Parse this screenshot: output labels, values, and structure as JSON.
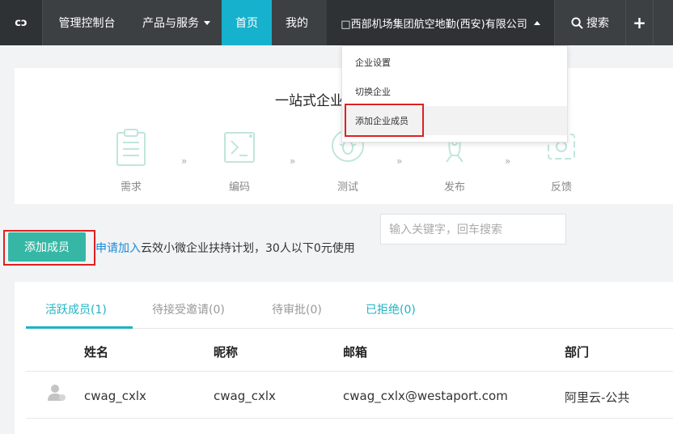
{
  "topbar": {
    "logo": "cɔ",
    "console": "管理控制台",
    "products": "产品与服务",
    "home": "首页",
    "mine": "我的",
    "company": "□西部机场集团航空地勤(西安)有限公司",
    "search": "搜索",
    "plus": "+"
  },
  "dropdown": {
    "items": [
      "企业设置",
      "切换企业",
      "添加企业成员"
    ]
  },
  "hero": {
    "title": "一站式企业",
    "steps": [
      "需求",
      "编码",
      "测试",
      "发布",
      "反馈"
    ],
    "arrow": "»"
  },
  "search_box": {
    "placeholder": "输入关键字，回车搜索"
  },
  "actions": {
    "add_member": "添加成员",
    "promo_link": "申请加入",
    "promo_text": "云效小微企业扶持计划，30人以下0元使用"
  },
  "members": {
    "tabs": [
      "活跃成员(1)",
      "待接受邀请(0)",
      "待审批(0)",
      "已拒绝(0)"
    ],
    "columns": [
      "姓名",
      "昵称",
      "邮箱",
      "部门"
    ],
    "rows": [
      {
        "name": "cwag_cxlx",
        "nickname": "cwag_cxlx",
        "email": "cwag_cxlx@westaport.com",
        "department": "阿里云-公共"
      }
    ]
  },
  "colors": {
    "topbar": "#3c4043",
    "accent": "#16b1cc",
    "add_button": "#36b7a5",
    "highlight_box": "#e02020",
    "link": "#1a8ad6"
  }
}
